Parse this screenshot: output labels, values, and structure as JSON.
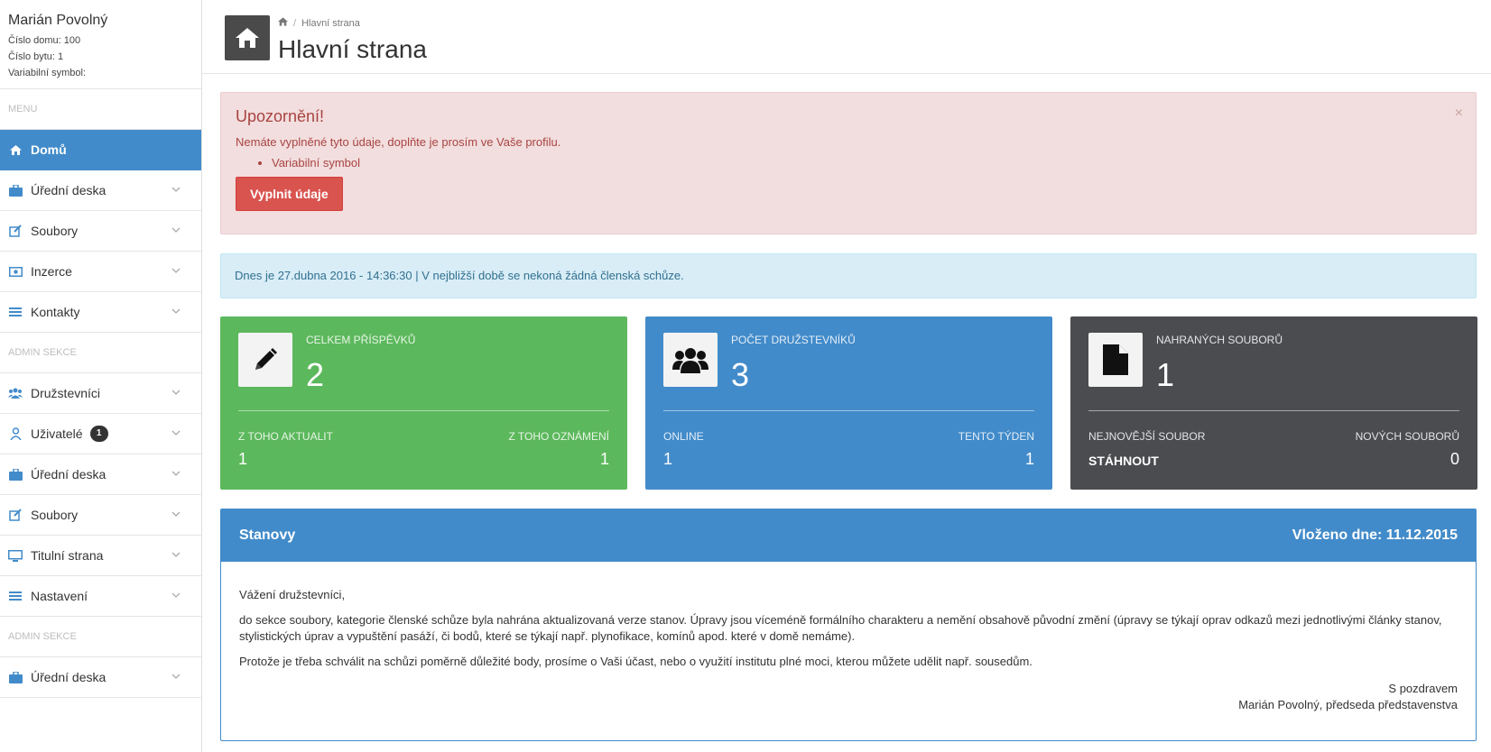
{
  "user": {
    "name": "Marián Povolný",
    "house": "Číslo domu: 100",
    "flat": "Číslo bytu: 1",
    "varsym": "Variabilní symbol:"
  },
  "sidebar": {
    "menu_title": "MENU",
    "admin_title_1": "ADMIN SEKCE",
    "admin_title_2": "ADMIN SEKCE",
    "items": [
      {
        "label": "Domů",
        "icon": "home-icon"
      },
      {
        "label": "Úřední deska",
        "icon": "briefcase-icon"
      },
      {
        "label": "Soubory",
        "icon": "edit-icon"
      },
      {
        "label": "Inzerce",
        "icon": "money-icon"
      },
      {
        "label": "Kontakty",
        "icon": "list-icon"
      }
    ],
    "admin_items": [
      {
        "label": "Družstevníci",
        "icon": "users-icon"
      },
      {
        "label": "Uživatelé",
        "icon": "user-icon",
        "badge": "1"
      },
      {
        "label": "Úřední deska",
        "icon": "briefcase-icon"
      },
      {
        "label": "Soubory",
        "icon": "edit-icon"
      },
      {
        "label": "Titulní strana",
        "icon": "monitor-icon"
      },
      {
        "label": "Nastavení",
        "icon": "list-icon"
      }
    ],
    "admin_items_2": [
      {
        "label": "Úřední deska",
        "icon": "briefcase-icon"
      }
    ]
  },
  "header": {
    "breadcrumb": "Hlavní strana",
    "title": "Hlavní strana"
  },
  "alert": {
    "title": "Upozornění!",
    "message": "Nemáte vyplněné tyto údaje, doplňte je prosím ve Vaše profilu.",
    "items": [
      "Variabilní symbol"
    ],
    "button": "Vyplnit údaje",
    "close": "×"
  },
  "info": {
    "text": "Dnes je 27.dubna 2016 - 14:36:30 | V nejbližší době se nekoná žádná členská schůze."
  },
  "cards": [
    {
      "title": "CELKEM PŘÍSPĚVKŮ",
      "value": "2",
      "left_label": "Z TOHO AKTUALIT",
      "left_value": "1",
      "right_label": "Z TOHO OZNÁMENÍ",
      "right_value": "1",
      "icon": "pencil-icon",
      "color": "#5cb85c"
    },
    {
      "title": "POČET DRUŽSTEVNÍKŮ",
      "value": "3",
      "left_label": "ONLINE",
      "left_value": "1",
      "right_label": "TENTO TÝDEN",
      "right_value": "1",
      "icon": "group-icon",
      "color": "#428bca"
    },
    {
      "title": "NAHRANÝCH SOUBORŮ",
      "value": "1",
      "left_label": "NEJNOVĚJŠÍ SOUBOR",
      "left_value": "STÁHNOUT",
      "right_label": "NOVÝCH SOUBORŮ",
      "right_value": "0",
      "icon": "file-icon",
      "color": "#4a4c4f"
    }
  ],
  "panel": {
    "title": "Stanovy",
    "date": "Vloženo dne: 11.12.2015",
    "greeting": "Vážení družstevníci,",
    "para1": "do sekce soubory, kategorie členské schůze byla nahrána aktualizovaná verze stanov. Úpravy jsou víceméně formálního charakteru a nemění obsahově původní změní (úpravy se týkají oprav odkazů mezi jednotlivými články stanov, stylistických úprav a vypuštění pasáží, či bodů, které se týkají např. plynofikace, komínů apod. které v domě nemáme).",
    "para2": "Protože je třeba schválit na schůzi poměrně důležité body, prosíme o Vaši účast, nebo o využití institutu plné moci, kterou můžete udělit např. sousedům.",
    "sign1": "S pozdravem",
    "sign2": "Marián Povolný, předseda představenstva"
  }
}
